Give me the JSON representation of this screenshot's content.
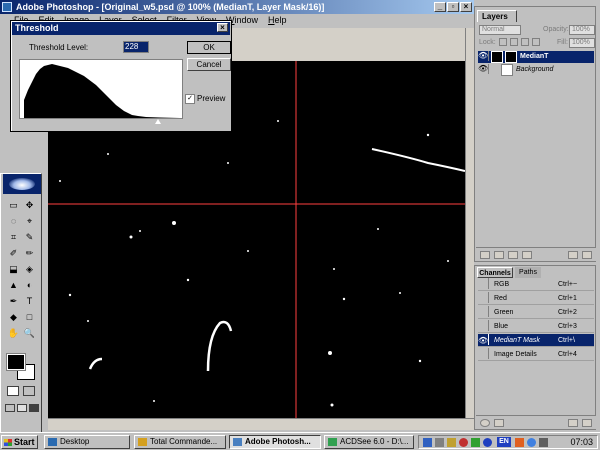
{
  "window": {
    "title": "Adobe Photoshop - [Original_w5.psd @ 100% (MedianT, Layer Mask/16)]",
    "controls": {
      "minimize": "_",
      "restore": "▫",
      "close": "×"
    }
  },
  "menu": [
    {
      "ul": "F",
      "rest": "ile"
    },
    {
      "ul": "E",
      "rest": "dit"
    },
    {
      "ul": "I",
      "rest": "mage"
    },
    {
      "ul": "L",
      "rest": "ayer"
    },
    {
      "ul": "S",
      "rest": "elect"
    },
    {
      "ul": "F",
      "rest": "ilter"
    },
    {
      "ul": "V",
      "rest": "iew"
    },
    {
      "ul": "W",
      "rest": "indow"
    },
    {
      "ul": "H",
      "rest": "elp"
    }
  ],
  "threshold_dialog": {
    "title": "Threshold",
    "close": "×",
    "level_label": "Threshold Level:",
    "level_value": "228",
    "ok": "OK",
    "cancel": "Cancel",
    "preview_label": "Preview",
    "preview_check": "✓"
  },
  "layers": {
    "tab": "Layers",
    "blend_mode": "Normal",
    "opacity_label": "Opacity:",
    "opacity_value": "100%",
    "lock_label": "Lock:",
    "fill_label": "Fill:",
    "fill_value": "100%",
    "items": [
      {
        "name": "MedianT",
        "selected": true
      },
      {
        "name": "Background",
        "selected": false
      }
    ]
  },
  "channels": {
    "tabs": [
      "Channels",
      "Paths"
    ],
    "items": [
      {
        "name": "RGB",
        "shortcut": "Ctrl+~",
        "selected": false
      },
      {
        "name": "Red",
        "shortcut": "Ctrl+1",
        "selected": false
      },
      {
        "name": "Green",
        "shortcut": "Ctrl+2",
        "selected": false
      },
      {
        "name": "Blue",
        "shortcut": "Ctrl+3",
        "selected": false
      },
      {
        "name": "MedianT Mask",
        "shortcut": "Ctrl+\\",
        "selected": true
      },
      {
        "name": "Image Details",
        "shortcut": "Ctrl+4",
        "selected": false
      }
    ]
  },
  "tools": [
    "▭",
    "✥",
    "◌",
    "⌖",
    "⌗",
    "✎",
    "✐",
    "✏",
    "⬓",
    "◈",
    "▲",
    "◐",
    "✒",
    "T",
    "◆",
    "□",
    "✋",
    "🔍"
  ],
  "taskbar": {
    "start": "Start",
    "tasks": [
      {
        "label": "Desktop",
        "active": false
      },
      {
        "label": "Total Commande...",
        "active": false
      },
      {
        "label": "Adobe Photosh...",
        "active": true
      },
      {
        "label": "ACDSee 6.0 - D:\\...",
        "active": false
      }
    ],
    "tray_lang": "EN",
    "clock": "07:03"
  },
  "colors": {
    "title_active": "#08246b",
    "guide": "#ff4040",
    "mask_bg": "#000000",
    "mask_fg": "#ffffff"
  }
}
